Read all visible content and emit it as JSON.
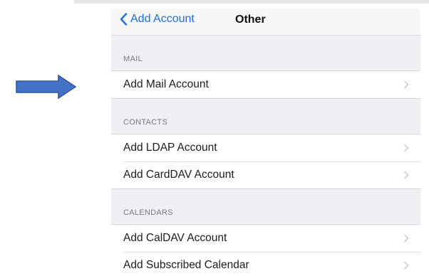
{
  "nav": {
    "back_label": "Add Account",
    "title": "Other"
  },
  "sections": [
    {
      "header": "MAIL",
      "items": [
        {
          "label": "Add Mail Account"
        }
      ]
    },
    {
      "header": "CONTACTS",
      "items": [
        {
          "label": "Add LDAP Account"
        },
        {
          "label": "Add CardDAV Account"
        }
      ]
    },
    {
      "header": "CALENDARS",
      "items": [
        {
          "label": "Add CalDAV Account"
        },
        {
          "label": "Add Subscribed Calendar"
        }
      ]
    }
  ],
  "annotation": {
    "icon": "right-arrow-icon",
    "color": "#4472c4"
  },
  "colors": {
    "accent": "#1f6fe5",
    "background": "#efeff4"
  }
}
